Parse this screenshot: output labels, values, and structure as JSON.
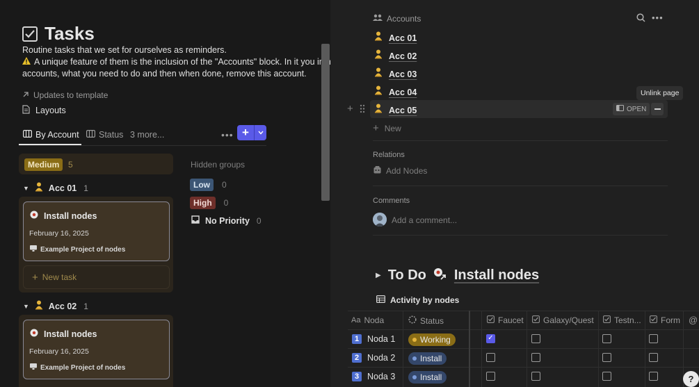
{
  "page": {
    "title": "Tasks",
    "desc_line1": "Routine tasks that we set for ourselves as reminders.",
    "desc_line2": "A unique feature of them is the inclusion of the \"Accounts\" block. In it you immediat",
    "desc_line3": "accounts, what you need to do and then when done, remove this account.",
    "updates_link": "Updates to template",
    "layouts_link": "Layouts"
  },
  "tabs": {
    "by_account": "By Account",
    "status": "Status",
    "more": "3 more...",
    "new_btn": "+"
  },
  "board": {
    "group_medium": "Medium",
    "group_medium_count": "5",
    "acc01_label": "Acc 01",
    "acc01_count": "1",
    "acc02_label": "Acc 02",
    "acc02_count": "1",
    "card1_title": "Install nodes",
    "card1_date": "February 16, 2025",
    "card1_project": "Example Project of nodes",
    "card2_title": "Install nodes",
    "card2_date": "February 16, 2025",
    "card2_project": "Example Project of nodes",
    "new_task": "New task",
    "hidden_groups": "Hidden groups",
    "low": "Low",
    "low_count": "0",
    "high": "High",
    "high_count": "0",
    "no_priority": "No Priority",
    "no_priority_count": "0"
  },
  "colors": {
    "medium_pill": "#8a6d16",
    "low_pill": "#3c5675",
    "high_pill": "#6e2f2a",
    "accent": "#5a5ae8",
    "card_bg": "#3f3425"
  },
  "right": {
    "accounts_header": "Accounts",
    "accounts": [
      "Acc 01",
      "Acc 02",
      "Acc 03",
      "Acc 04",
      "Acc 05"
    ],
    "unlink_tooltip": "Unlink page",
    "open_btn": "OPEN",
    "new_label": "New",
    "relations": "Relations",
    "add_nodes": "Add Nodes",
    "comments": "Comments",
    "comment_placeholder": "Add a comment...",
    "todo": "To Do",
    "install_nodes": "Install nodes",
    "activity": "Activity by nodes"
  },
  "table": {
    "headers": [
      "Noda",
      "Status",
      "Faucet",
      "Galaxy/Quest",
      "Testn...",
      "Form"
    ],
    "rows": [
      {
        "num": "1",
        "name": "Noda 1",
        "status": "Working",
        "faucet": true
      },
      {
        "num": "2",
        "name": "Noda 2",
        "status": "Install",
        "faucet": false
      },
      {
        "num": "3",
        "name": "Noda 3",
        "status": "Install",
        "faucet": false
      }
    ]
  }
}
